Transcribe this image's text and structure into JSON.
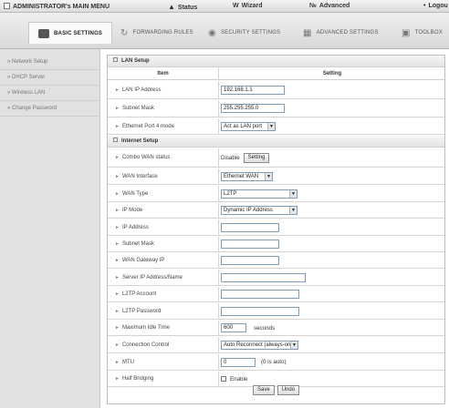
{
  "topbar": {
    "title": "ADMINISTRATOR's MAIN MENU",
    "status": "Status",
    "wizard": "Wizard",
    "advanced": "Advanced",
    "logout": "Logou"
  },
  "tabs": [
    {
      "label": "BASIC SETTINGS"
    },
    {
      "label": "FORWARDING RULES"
    },
    {
      "label": "SECURITY SETTINGS"
    },
    {
      "label": "ADVANCED SETTINGS"
    },
    {
      "label": "TOOLBOX"
    }
  ],
  "sidebar": {
    "items": [
      {
        "label": "Network Setup"
      },
      {
        "label": "DHCP Server"
      },
      {
        "label": "Wireless LAN"
      },
      {
        "label": "Change Password"
      }
    ]
  },
  "lan": {
    "title": "LAN Setup",
    "col_item": "Item",
    "col_setting": "Setting",
    "ip_label": "LAN IP Address",
    "ip_value": "192.168.1.1",
    "mask_label": "Subnet Mask",
    "mask_value": "255.255.255.0",
    "port4_label": "Ethernet Port 4 mode",
    "port4_value": "Act as LAN port"
  },
  "wan": {
    "title": "Internet Setup",
    "combo_label": "Combo WAN status",
    "combo_value": "Disable",
    "combo_button": "Setting",
    "iface_label": "WAN Interface",
    "iface_value": "Ethernet WAN",
    "type_label": "WAN Type",
    "type_value": "L2TP",
    "ipmode_label": "IP Mode",
    "ipmode_value": "Dynamic IP Address",
    "ip_label": "IP Address",
    "mask_label": "Subnet Mask",
    "gw_label": "WAN Gateway IP",
    "server_label": "Server IP Address/Name",
    "account_label": "L2TP Account",
    "password_label": "L2TP Password",
    "idle_label": "Maximum Idle Time",
    "idle_value": "600",
    "idle_unit": "seconds",
    "conn_label": "Connection Control",
    "conn_value": "Auto Reconnect (always-on)",
    "mtu_label": "MTU",
    "mtu_value": "0",
    "mtu_note": "(0 is auto)",
    "hb_label": "Half Bridging",
    "hb_value": "Enable"
  },
  "actions": {
    "save": "Save",
    "undo": "Undo"
  }
}
